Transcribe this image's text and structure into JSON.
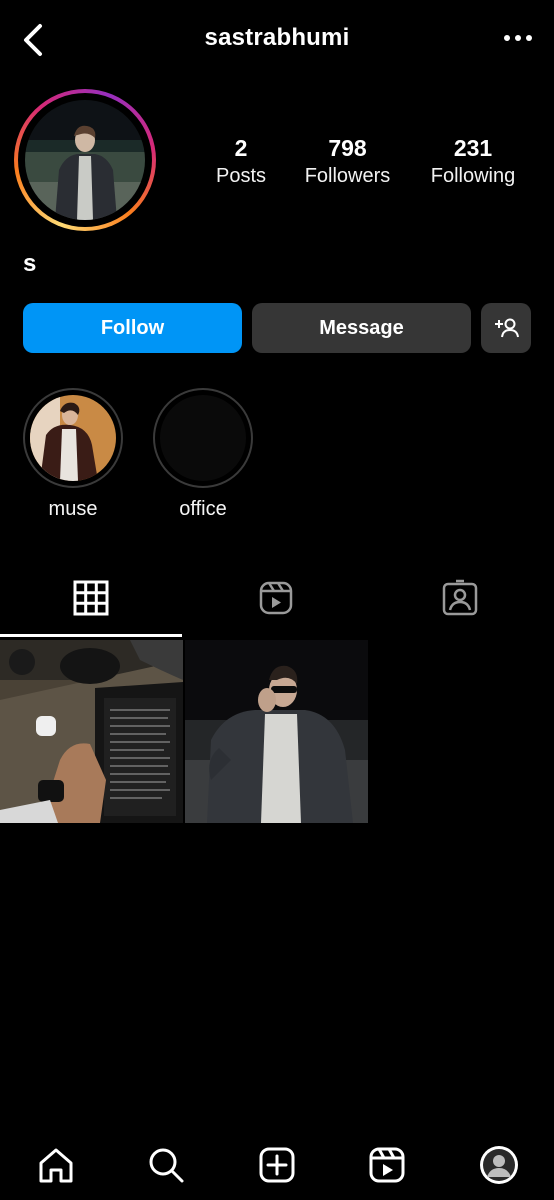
{
  "header": {
    "username": "sastrabhumi",
    "back_icon": "chevron-left-icon",
    "more_icon": "more-horizontal-icon"
  },
  "profile": {
    "display_name": "s",
    "stats": [
      {
        "value": "2",
        "label": "Posts"
      },
      {
        "value": "798",
        "label": "Followers"
      },
      {
        "value": "231",
        "label": "Following"
      }
    ],
    "story_ring_colors": [
      "#feda75",
      "#fa7e1e",
      "#d62976",
      "#962fbf"
    ]
  },
  "actions": {
    "follow_label": "Follow",
    "message_label": "Message",
    "add_user_icon": "add-user-icon",
    "follow_color": "#0095f6",
    "secondary_color": "#363636"
  },
  "highlights": [
    {
      "label": "muse"
    },
    {
      "label": "office"
    }
  ],
  "tabs": [
    {
      "icon": "grid-icon",
      "active": true
    },
    {
      "icon": "reels-icon",
      "active": false
    },
    {
      "icon": "tagged-icon",
      "active": false
    }
  ],
  "bottom_nav": [
    {
      "icon": "home-icon"
    },
    {
      "icon": "search-icon"
    },
    {
      "icon": "create-icon"
    },
    {
      "icon": "reels-icon"
    },
    {
      "icon": "profile-avatar-icon"
    }
  ]
}
